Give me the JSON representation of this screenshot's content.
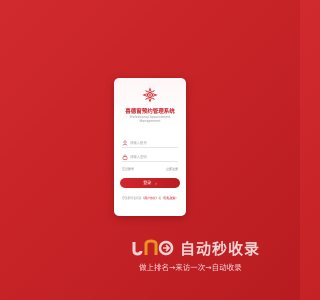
{
  "card": {
    "title": "喜德窗预约管理系统",
    "subtitle_line1": "Professional Appointment",
    "subtitle_line2": "Management",
    "logo_icon": "ornament-icon",
    "accent_color": "#c8242a"
  },
  "form": {
    "username": {
      "placeholder": "请输入账号",
      "value": "",
      "icon": "user-icon"
    },
    "password": {
      "placeholder": "请输入密码",
      "value": "",
      "icon": "lock-icon"
    },
    "forgot_label": "忘记账号",
    "register_label": "立即注册",
    "login_label": "登录",
    "login_arrow": "›"
  },
  "footer": {
    "prefix": "登录即代表同意",
    "agreement": "《用户协议》",
    "and": "和",
    "privacy": "《隐私政策》"
  },
  "watermark": {
    "title": "自动秒收录",
    "subtitle": "做上排名→来访一次→自动收录",
    "icon": "jn-logo-icon"
  }
}
